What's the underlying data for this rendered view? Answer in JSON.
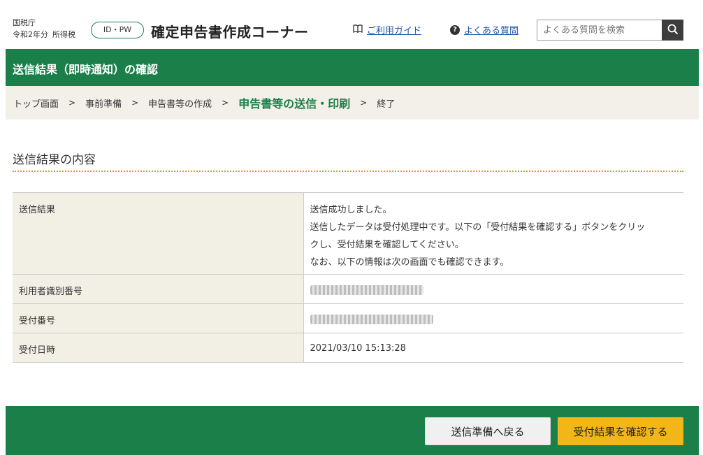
{
  "header": {
    "agency_name": "国税庁",
    "tax_year": "令和2年分",
    "tax_type": "所得税",
    "auth_method": "ID・PW",
    "app_title": "確定申告書作成コーナー",
    "guide_link": "ご利用ガイド",
    "faq_link": "よくある質問",
    "search_placeholder": "よくある質問を検索",
    "icons": {
      "guide": "book-icon",
      "faq": "question-circle-icon",
      "search": "search-icon"
    }
  },
  "page_title": "送信結果（即時通知）の確認",
  "breadcrumb": {
    "steps": [
      "トップ画面",
      "事前準備",
      "申告書等の作成",
      "申告書等の送信・印刷",
      "終了"
    ],
    "current_index": 3
  },
  "section_title": "送信結果の内容",
  "result_table": {
    "rows": [
      {
        "label": "送信結果",
        "lines": [
          "送信成功しました。",
          "送信したデータは受付処理中です。以下の「受付結果を確認する」ボタンをクリッ",
          "クし、受付結果を確認してください。",
          "なお、以下の情報は次の画面でも確認できます。"
        ]
      },
      {
        "label": "利用者識別番号",
        "masked": true
      },
      {
        "label": "受付番号",
        "masked": true
      },
      {
        "label": "受付日時",
        "value": "2021/03/10 15:13:28"
      }
    ]
  },
  "buttons": {
    "back": "送信準備へ戻る",
    "confirm": "受付結果を確認する"
  },
  "colors": {
    "brand_green": "#1b7f4a",
    "accent_orange": "#f2b619",
    "breadcrumb_bg": "#f2f0e8",
    "link_blue": "#1a56a8"
  }
}
